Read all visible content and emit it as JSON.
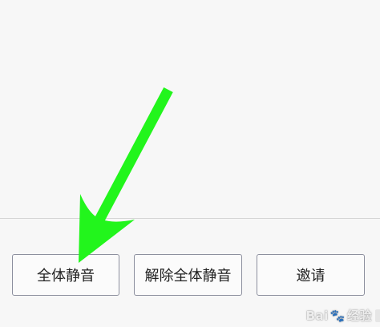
{
  "toolbar": {
    "mute_all_label": "全体静音",
    "unmute_all_label": "解除全体静音",
    "invite_label": "邀请"
  },
  "annotation": {
    "arrow_color": "#22f51c"
  },
  "watermark": {
    "brand": "Bai",
    "suffix": "经验"
  },
  "colors": {
    "background": "#f7f7f7",
    "button_border": "#8c8f9e",
    "divider": "#d5d5d5"
  }
}
